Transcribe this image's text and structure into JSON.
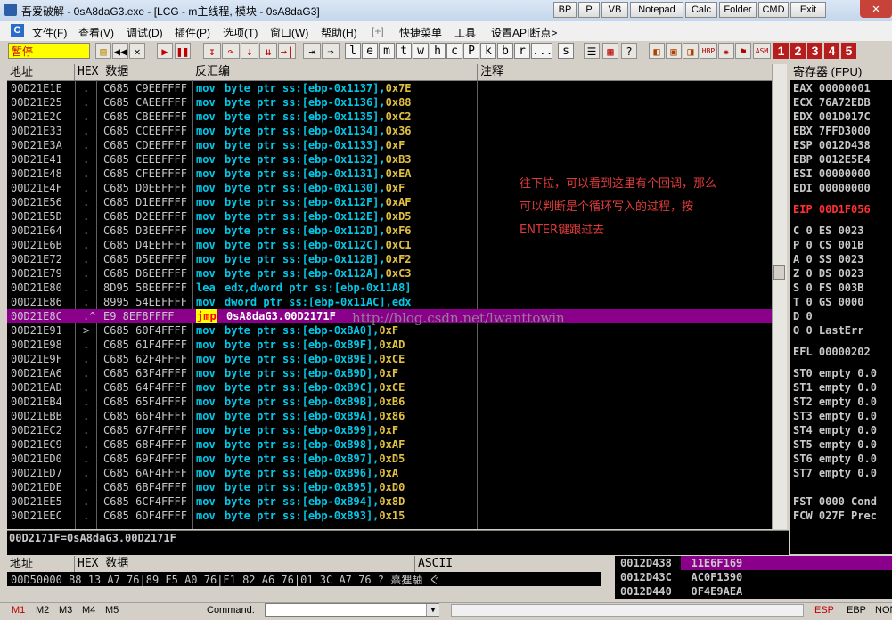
{
  "window": {
    "title": "吾爱破解 - 0sA8daG3.exe - [LCG - m主线程, 模块 - 0sA8daG3]",
    "top_buttons": [
      "BP",
      "P",
      "VB",
      "Notepad",
      "Calc",
      "Folder",
      "CMD",
      "Exit"
    ]
  },
  "menu": {
    "logo": "C",
    "items": [
      "文件(F)",
      "查看(V)",
      "调试(D)",
      "插件(P)",
      "选项(T)",
      "窗口(W)",
      "帮助(H)",
      "[+]",
      "快捷菜单",
      "工具",
      "设置API断点>"
    ]
  },
  "toolbar": {
    "status": "暂停",
    "letter_buttons": [
      "l",
      "e",
      "m",
      "t",
      "w",
      "h",
      "c",
      "P",
      "k",
      "b",
      "r",
      "...",
      "s"
    ],
    "number_buttons": [
      "1",
      "2",
      "3",
      "4",
      "5"
    ]
  },
  "disasm": {
    "headers": {
      "addr": "地址",
      "hex": "HEX 数据",
      "disasm": "反汇编",
      "comment": "注释"
    },
    "rows": [
      {
        "addr": "00D21E1E",
        "mark": ".",
        "hex": "C685 C9EEFFFF",
        "op": "mov",
        "args": "byte ptr ss:[ebp-0x1137],",
        "imm": "0x7E"
      },
      {
        "addr": "00D21E25",
        "mark": ".",
        "hex": "C685 CAEEFFFF",
        "op": "mov",
        "args": "byte ptr ss:[ebp-0x1136],",
        "imm": "0x88"
      },
      {
        "addr": "00D21E2C",
        "mark": ".",
        "hex": "C685 CBEEFFFF",
        "op": "mov",
        "args": "byte ptr ss:[ebp-0x1135],",
        "imm": "0xC2"
      },
      {
        "addr": "00D21E33",
        "mark": ".",
        "hex": "C685 CCEEFFFF",
        "op": "mov",
        "args": "byte ptr ss:[ebp-0x1134],",
        "imm": "0x36"
      },
      {
        "addr": "00D21E3A",
        "mark": ".",
        "hex": "C685 CDEEFFFF",
        "op": "mov",
        "args": "byte ptr ss:[ebp-0x1133],",
        "imm": "0xF"
      },
      {
        "addr": "00D21E41",
        "mark": ".",
        "hex": "C685 CEEEFFFF",
        "op": "mov",
        "args": "byte ptr ss:[ebp-0x1132],",
        "imm": "0xB3"
      },
      {
        "addr": "00D21E48",
        "mark": ".",
        "hex": "C685 CFEEFFFF",
        "op": "mov",
        "args": "byte ptr ss:[ebp-0x1131],",
        "imm": "0xEA"
      },
      {
        "addr": "00D21E4F",
        "mark": ".",
        "hex": "C685 D0EEFFFF",
        "op": "mov",
        "args": "byte ptr ss:[ebp-0x1130],",
        "imm": "0xF"
      },
      {
        "addr": "00D21E56",
        "mark": ".",
        "hex": "C685 D1EEFFFF",
        "op": "mov",
        "args": "byte ptr ss:[ebp-0x112F],",
        "imm": "0xAF"
      },
      {
        "addr": "00D21E5D",
        "mark": ".",
        "hex": "C685 D2EEFFFF",
        "op": "mov",
        "args": "byte ptr ss:[ebp-0x112E],",
        "imm": "0xD5"
      },
      {
        "addr": "00D21E64",
        "mark": ".",
        "hex": "C685 D3EEFFFF",
        "op": "mov",
        "args": "byte ptr ss:[ebp-0x112D],",
        "imm": "0xF6"
      },
      {
        "addr": "00D21E6B",
        "mark": ".",
        "hex": "C685 D4EEFFFF",
        "op": "mov",
        "args": "byte ptr ss:[ebp-0x112C],",
        "imm": "0xC1"
      },
      {
        "addr": "00D21E72",
        "mark": ".",
        "hex": "C685 D5EEFFFF",
        "op": "mov",
        "args": "byte ptr ss:[ebp-0x112B],",
        "imm": "0xF2"
      },
      {
        "addr": "00D21E79",
        "mark": ".",
        "hex": "C685 D6EEFFFF",
        "op": "mov",
        "args": "byte ptr ss:[ebp-0x112A],",
        "imm": "0xC3"
      },
      {
        "addr": "00D21E80",
        "mark": ".",
        "hex": "8D95 58EEFFFF",
        "op": "lea",
        "args": "edx,dword ptr ss:[ebp-0x11A8]",
        "imm": ""
      },
      {
        "addr": "00D21E86",
        "mark": ".",
        "hex": "8995 54EEFFFF",
        "op": "mov",
        "args": "dword ptr ss:[ebp-0x11AC],edx",
        "imm": ""
      },
      {
        "addr": "00D21E8C",
        "mark": ".^",
        "hex": "E9 8EF8FFFF",
        "op": "jmp",
        "args": "0sA8daG3.00D2171F",
        "imm": "",
        "selected": true
      },
      {
        "addr": "00D21E91",
        "mark": ">",
        "hex": "C685 60F4FFFF",
        "op": "mov",
        "args": "byte ptr ss:[ebp-0xBA0],",
        "imm": "0xF"
      },
      {
        "addr": "00D21E98",
        "mark": ".",
        "hex": "C685 61F4FFFF",
        "op": "mov",
        "args": "byte ptr ss:[ebp-0xB9F],",
        "imm": "0xAD"
      },
      {
        "addr": "00D21E9F",
        "mark": ".",
        "hex": "C685 62F4FFFF",
        "op": "mov",
        "args": "byte ptr ss:[ebp-0xB9E],",
        "imm": "0xCE"
      },
      {
        "addr": "00D21EA6",
        "mark": ".",
        "hex": "C685 63F4FFFF",
        "op": "mov",
        "args": "byte ptr ss:[ebp-0xB9D],",
        "imm": "0xF"
      },
      {
        "addr": "00D21EAD",
        "mark": ".",
        "hex": "C685 64F4FFFF",
        "op": "mov",
        "args": "byte ptr ss:[ebp-0xB9C],",
        "imm": "0xCE"
      },
      {
        "addr": "00D21EB4",
        "mark": ".",
        "hex": "C685 65F4FFFF",
        "op": "mov",
        "args": "byte ptr ss:[ebp-0xB9B],",
        "imm": "0xB6"
      },
      {
        "addr": "00D21EBB",
        "mark": ".",
        "hex": "C685 66F4FFFF",
        "op": "mov",
        "args": "byte ptr ss:[ebp-0xB9A],",
        "imm": "0x86"
      },
      {
        "addr": "00D21EC2",
        "mark": ".",
        "hex": "C685 67F4FFFF",
        "op": "mov",
        "args": "byte ptr ss:[ebp-0xB99],",
        "imm": "0xF"
      },
      {
        "addr": "00D21EC9",
        "mark": ".",
        "hex": "C685 68F4FFFF",
        "op": "mov",
        "args": "byte ptr ss:[ebp-0xB98],",
        "imm": "0xAF"
      },
      {
        "addr": "00D21ED0",
        "mark": ".",
        "hex": "C685 69F4FFFF",
        "op": "mov",
        "args": "byte ptr ss:[ebp-0xB97],",
        "imm": "0xD5"
      },
      {
        "addr": "00D21ED7",
        "mark": ".",
        "hex": "C685 6AF4FFFF",
        "op": "mov",
        "args": "byte ptr ss:[ebp-0xB96],",
        "imm": "0xA"
      },
      {
        "addr": "00D21EDE",
        "mark": ".",
        "hex": "C685 6BF4FFFF",
        "op": "mov",
        "args": "byte ptr ss:[ebp-0xB95],",
        "imm": "0xD0"
      },
      {
        "addr": "00D21EE5",
        "mark": ".",
        "hex": "C685 6CF4FFFF",
        "op": "mov",
        "args": "byte ptr ss:[ebp-0xB94],",
        "imm": "0x8D"
      },
      {
        "addr": "00D21EEC",
        "mark": ".",
        "hex": "C685 6DF4FFFF",
        "op": "mov",
        "args": "byte ptr ss:[ebp-0xB93],",
        "imm": "0x15"
      }
    ],
    "comment_lines": [
      "往下拉，可以看到这里有个回调，那么",
      "可以判断是个循环写入的过程，按",
      "ENTER键跟过去"
    ],
    "watermark": "http://blog.csdn.net/lwanttowin"
  },
  "registers": {
    "header": "寄存器 (FPU)",
    "lines": [
      {
        "text": "EAX 00000001"
      },
      {
        "text": "ECX 76A72EDB"
      },
      {
        "text": "EDX 001D017C"
      },
      {
        "text": "EBX 7FFD3000"
      },
      {
        "text": "ESP 0012D438"
      },
      {
        "text": "EBP 0012E5E4"
      },
      {
        "text": "ESI 00000000"
      },
      {
        "text": "EDI 00000000"
      },
      {
        "text": "EIP 00D1F056",
        "red": true
      },
      {
        "text": "C 0  ES 0023"
      },
      {
        "text": "P 0  CS 001B"
      },
      {
        "text": "A 0  SS 0023"
      },
      {
        "text": "Z 0  DS 0023"
      },
      {
        "text": "S 0  FS 003B"
      },
      {
        "text": "T 0  GS 0000"
      },
      {
        "text": "D 0"
      },
      {
        "text": "O 0  LastErr"
      },
      {
        "text": "EFL 00000202"
      },
      {
        "text": "ST0 empty 0.0"
      },
      {
        "text": "ST1 empty 0.0"
      },
      {
        "text": "ST2 empty 0.0"
      },
      {
        "text": "ST3 empty 0.0"
      },
      {
        "text": "ST4 empty 0.0"
      },
      {
        "text": "ST5 empty 0.0"
      },
      {
        "text": "ST6 empty 0.0"
      },
      {
        "text": "ST7 empty 0.0"
      },
      {
        "text": "FST 0000  Cond"
      },
      {
        "text": "FCW 027F  Prec"
      }
    ]
  },
  "info_line": "00D2171F=0sA8daG3.00D2171F",
  "dump": {
    "headers": {
      "addr": "地址",
      "hex": "HEX 数据",
      "ascii": "ASCII"
    },
    "row": "00D50000 B8 13 A7 76|89 F5 A0 76|F1 82 A6 76|01 3C A7 76 ?  熹狸駎  ぐ"
  },
  "stack": [
    {
      "addr": "0012D438",
      "val": "11E6F169"
    },
    {
      "addr": "0012D43C",
      "val": "AC0F1390"
    },
    {
      "addr": "0012D440",
      "val": "0F4E9AEA"
    }
  ],
  "bottom": {
    "m_tabs": [
      "M1",
      "M2",
      "M3",
      "M4",
      "M5"
    ],
    "command_label": "Command:",
    "right_labels": [
      "ESP",
      "EBP",
      "NON"
    ]
  },
  "colors": {
    "selection": "#8b008b",
    "accent_red": "#b81d1d",
    "comment_red": "#e03b3b"
  }
}
